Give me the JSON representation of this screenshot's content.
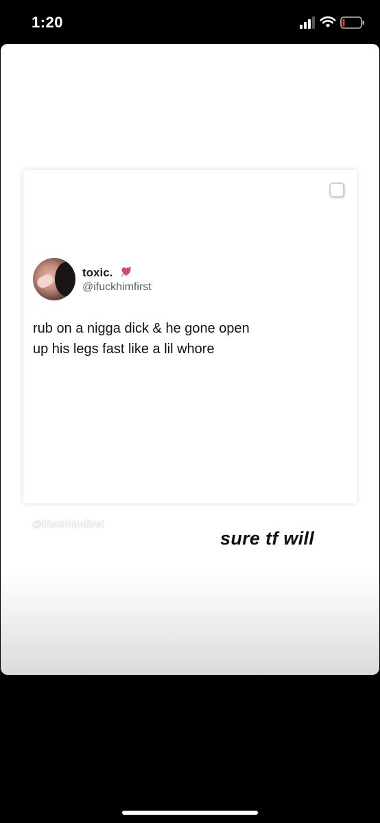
{
  "status_bar": {
    "time": "1:20"
  },
  "tweet": {
    "display_name": "toxic.",
    "display_name_emoji": "heart-with-arrow-icon",
    "handle": "@ifuckhimfirst",
    "text_line_1": "rub on a nigga dick & he gone open",
    "text_line_2": "up his legs fast like a lil whore"
  },
  "watermark": "@ifuckhimfirst",
  "caption": "sure tf will",
  "colors": {
    "background": "#000000",
    "card": "#ffffff",
    "heart": "#e0407a"
  }
}
